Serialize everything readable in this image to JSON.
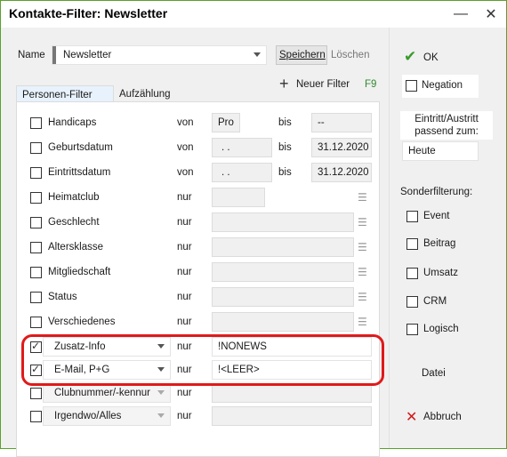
{
  "window": {
    "title": "Kontakte-Filter: Newsletter"
  },
  "titlebar_icons": {
    "minimize": "minimize-icon",
    "close": "close-icon"
  },
  "name_row": {
    "label": "Name",
    "value": "Newsletter",
    "save_label": "Speichern",
    "delete_label": "Löschen"
  },
  "new_filter": {
    "label": "Neuer Filter",
    "shortcut": "F9"
  },
  "tabs": [
    {
      "label": "Personen-Filter",
      "active": true
    },
    {
      "label": "Aufzählung",
      "active": false
    }
  ],
  "rows": [
    {
      "label": "Handicaps",
      "checked": false,
      "op": "von",
      "from": "Pro",
      "bis": "bis",
      "to": "--"
    },
    {
      "label": "Geburtsdatum",
      "checked": false,
      "op": "von",
      "from": ". .",
      "bis": "bis",
      "to": "31.12.2020"
    },
    {
      "label": "Eintrittsdatum",
      "checked": false,
      "op": "von",
      "from": ". .",
      "bis": "bis",
      "to": "31.12.2020"
    },
    {
      "label": "Heimatclub",
      "checked": false,
      "op": "nur",
      "value": ""
    },
    {
      "label": "Geschlecht",
      "checked": false,
      "op": "nur",
      "value": ""
    },
    {
      "label": "Altersklasse",
      "checked": false,
      "op": "nur",
      "value": ""
    },
    {
      "label": "Mitgliedschaft",
      "checked": false,
      "op": "nur",
      "value": ""
    },
    {
      "label": "Status",
      "checked": false,
      "op": "nur",
      "value": ""
    },
    {
      "label": "Verschiedenes",
      "checked": false,
      "op": "nur",
      "value": ""
    }
  ],
  "combo_rows": [
    {
      "combo": "Zusatz-Info",
      "checked": true,
      "op": "nur",
      "value": "!NONEWS"
    },
    {
      "combo": "E-Mail, P+G",
      "checked": true,
      "op": "nur",
      "value": "!<LEER>"
    },
    {
      "combo": "Clubnummer/-kennur",
      "checked": false,
      "op": "nur",
      "value": ""
    },
    {
      "combo": "Irgendwo/Alles",
      "checked": false,
      "op": "nur",
      "value": ""
    }
  ],
  "right_panel": {
    "ok_label": "OK",
    "negation_label": "Negation",
    "eintritt_label_1": "Eintritt/Austritt",
    "eintritt_label_2": "passend zum:",
    "eintritt_value": "Heute",
    "sonder_label": "Sonderfilterung:",
    "sonder_items": [
      "Event",
      "Beitrag",
      "Umsatz",
      "CRM",
      "Logisch"
    ],
    "datei_label": "Datei",
    "abbruch_label": "Abbruch"
  },
  "colors": {
    "border_green": "#5aa02c",
    "ok_check": "#3a9a2a",
    "abbruch_x": "#d01a1a",
    "highlight": "#e01a1a"
  }
}
